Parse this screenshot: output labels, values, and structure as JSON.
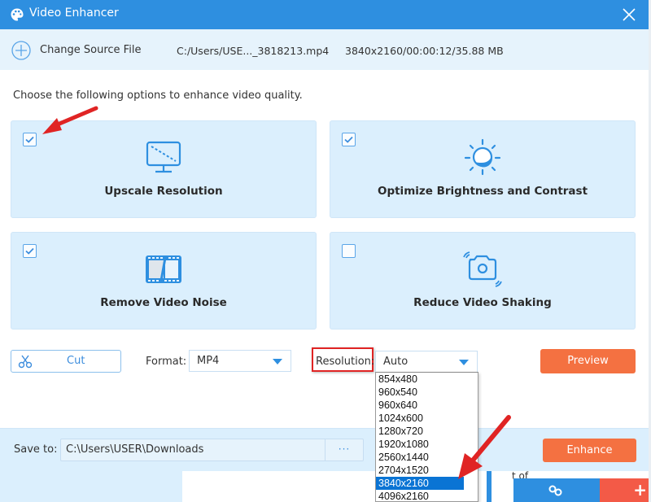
{
  "window": {
    "title": "Video Enhancer",
    "icon": "palette-icon",
    "close_icon": "close-icon"
  },
  "source": {
    "change_label": "Change Source File",
    "file_path": "C:/Users/USE..._3818213.mp4",
    "file_info": "3840x2160/00:00:12/35.88 MB"
  },
  "instruction": "Choose the following options to enhance video quality.",
  "options": [
    {
      "label": "Upscale Resolution",
      "checked": true,
      "icon": "monitor-icon"
    },
    {
      "label": "Optimize Brightness and Contrast",
      "checked": true,
      "icon": "brightness-icon"
    },
    {
      "label": "Remove Video Noise",
      "checked": true,
      "icon": "film-icon"
    },
    {
      "label": "Reduce Video Shaking",
      "checked": false,
      "icon": "shaking-camera-icon"
    }
  ],
  "controls": {
    "cut_label": "Cut",
    "format_label": "Format:",
    "format_value": "MP4",
    "resolution_label": "Resolution:",
    "resolution_value": "Auto",
    "preview_label": "Preview"
  },
  "resolution_options": [
    "854x480",
    "960x540",
    "960x640",
    "1024x600",
    "1280x720",
    "1920x1080",
    "2560x1440",
    "2704x1520",
    "3840x2160",
    "4096x2160"
  ],
  "resolution_highlighted": "3840x2160",
  "save": {
    "label": "Save to:",
    "path": "C:\\Users\\USER\\Downloads",
    "browse_label": "···",
    "enhance_label": "Enhance"
  },
  "background": {
    "partial_text": "t of",
    "plus_label": "+"
  },
  "colors": {
    "title_bar": "#2e8fe0",
    "accent": "#2e8fe0",
    "orange_button": "#f47141",
    "card_bg": "#dbeffd",
    "selected_option": "#0a74d4",
    "annotation_red": "#e02424"
  }
}
